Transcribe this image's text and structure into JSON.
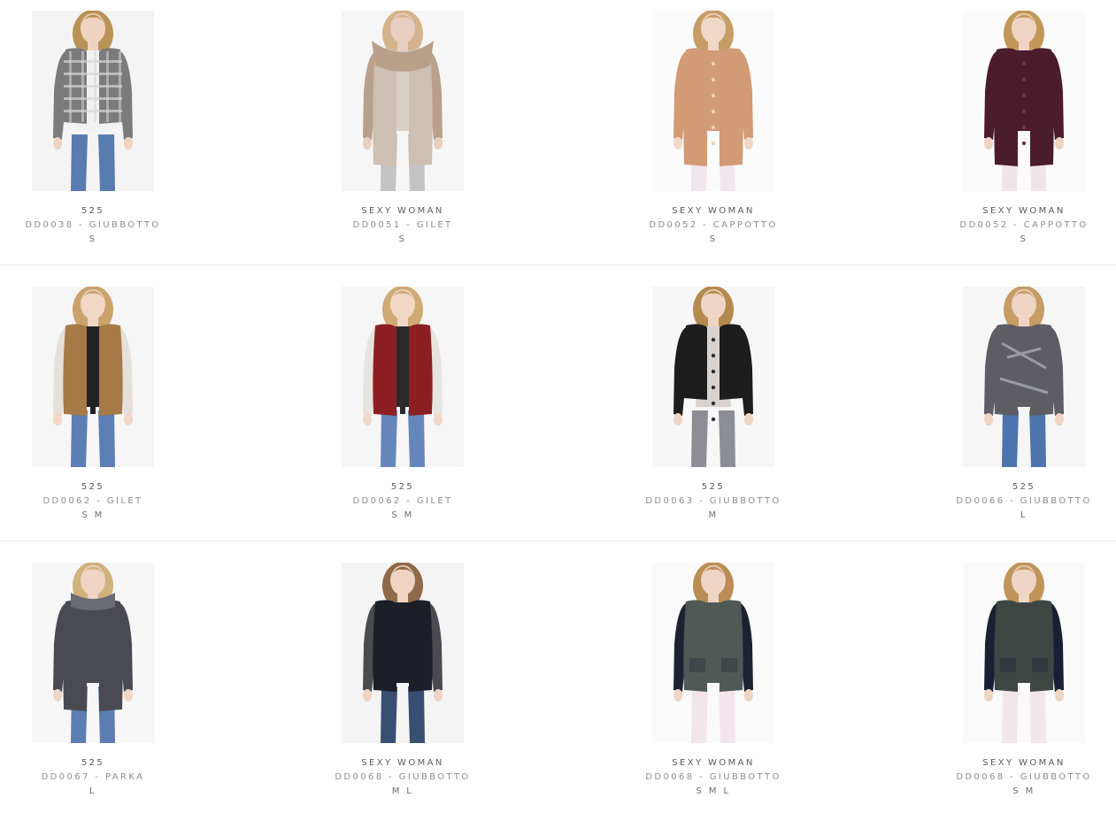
{
  "products": [
    {
      "brand": "525",
      "title": "DD0038 - GIUBBOTTO",
      "sizes": "S",
      "image": {
        "icon": "product-photo",
        "garment": "plaid-jacket",
        "colors": {
          "bg": "#f4f4f4",
          "hair": "#b99257",
          "skin": "#efd3c1",
          "coat": "#7b7b7b",
          "accent": "#d5d5d5",
          "inner": "#f1f1f1",
          "legs": "#587bb0"
        }
      }
    },
    {
      "brand": "SEXY WOMAN",
      "title": "DD0051 - GILET",
      "sizes": "S",
      "image": {
        "icon": "product-photo",
        "garment": "fur-collar-gilet",
        "colors": {
          "bg": "#f6f6f6",
          "hair": "#d4b38d",
          "skin": "#e7cfc1",
          "coat": "#cdbfb1",
          "accent": "#b9a08a",
          "inner": "#d7cfc8",
          "legs": "#c4c4c4"
        }
      }
    },
    {
      "brand": "SEXY WOMAN",
      "title": "DD0052 - CAPPOTTO",
      "sizes": "S",
      "image": {
        "icon": "product-photo",
        "garment": "plush-coat",
        "colors": {
          "bg": "#fbfbfb",
          "hair": "#c69d66",
          "skin": "#f0d8c8",
          "coat": "#d29a75",
          "accent": "#efcfb6",
          "inner": "#d29a75",
          "legs": "#f2e6ee"
        }
      }
    },
    {
      "brand": "SEXY WOMAN",
      "title": "DD0052 - CAPPOTTO",
      "sizes": "S",
      "image": {
        "icon": "product-photo",
        "garment": "velvet-coat",
        "colors": {
          "bg": "#fbfbfb",
          "hair": "#c29858",
          "skin": "#efd4c4",
          "coat": "#4a1c2c",
          "accent": "#6d3449",
          "inner": "#4a1c2c",
          "legs": "#f0e4ea"
        }
      }
    },
    {
      "brand": "525",
      "title": "DD0062 - GILET",
      "sizes": "S M",
      "image": {
        "icon": "product-photo",
        "garment": "faux-fur-vest",
        "colors": {
          "bg": "#f6f6f6",
          "hair": "#caa26b",
          "skin": "#f0d7c6",
          "coat": "#a57a46",
          "accent": "#e5e0da",
          "inner": "#222222",
          "legs": "#5b7eb4"
        }
      }
    },
    {
      "brand": "525",
      "title": "DD0062 - GILET",
      "sizes": "S M",
      "image": {
        "icon": "product-photo",
        "garment": "red-fur-vest",
        "colors": {
          "bg": "#f6f6f6",
          "hair": "#d0aa74",
          "skin": "#f0d7c6",
          "coat": "#8d1f22",
          "accent": "#e7e3de",
          "inner": "#2a2a2a",
          "legs": "#6486bb"
        }
      }
    },
    {
      "brand": "525",
      "title": "DD0063 - GIUBBOTTO",
      "sizes": "M",
      "image": {
        "icon": "product-photo",
        "garment": "shaggy-jacket",
        "colors": {
          "bg": "#f7f7f7",
          "hair": "#b58a4f",
          "skin": "#efd5c5",
          "coat": "#1d1d1d",
          "accent": "#303030",
          "inner": "#d9d3cf",
          "legs": "#8d8e95"
        }
      }
    },
    {
      "brand": "525",
      "title": "DD0066 - GIUBBOTTO",
      "sizes": "L",
      "image": {
        "icon": "product-photo",
        "garment": "metallic-jacket",
        "colors": {
          "bg": "#f6f6f6",
          "hair": "#c59d65",
          "skin": "#efd4c3",
          "coat": "#5d5d63",
          "accent": "#9b9ca2",
          "inner": "#5d5d63",
          "legs": "#4e74ad"
        }
      }
    },
    {
      "brand": "525",
      "title": "DD0067 - PARKA",
      "sizes": "L",
      "image": {
        "icon": "product-photo",
        "garment": "parka",
        "colors": {
          "bg": "#f7f7f7",
          "hair": "#d1b17c",
          "skin": "#efd5c5",
          "coat": "#4a4a52",
          "accent": "#6b6b74",
          "inner": "#4a4a52",
          "legs": "#5b7db1"
        }
      }
    },
    {
      "brand": "SEXY WOMAN",
      "title": "DD0068 - GIUBBOTTO",
      "sizes": "M L",
      "image": {
        "icon": "product-photo",
        "garment": "wool-jacket-leather-sleeves",
        "colors": {
          "bg": "#f4f4f4",
          "hair": "#8f6a48",
          "skin": "#efd4c4",
          "coat": "#1c1f28",
          "accent": "#4a4a4f",
          "inner": "#1c1f28",
          "legs": "#394f72"
        }
      }
    },
    {
      "brand": "SEXY WOMAN",
      "title": "DD0068 - GIUBBOTTO",
      "sizes": "S M L",
      "image": {
        "icon": "product-photo",
        "garment": "field-jacket",
        "colors": {
          "bg": "#fafafa",
          "hair": "#b98d54",
          "skin": "#efd5c5",
          "coat": "#505955",
          "accent": "#1d2233",
          "inner": "#505955",
          "legs": "#f2e6ec"
        }
      }
    },
    {
      "brand": "SEXY WOMAN",
      "title": "DD0068 - GIUBBOTTO",
      "sizes": "S M",
      "image": {
        "icon": "product-photo",
        "garment": "field-jacket",
        "colors": {
          "bg": "#fafafa",
          "hair": "#bf9559",
          "skin": "#efd5c5",
          "coat": "#3f4744",
          "accent": "#192033",
          "inner": "#3f4744",
          "legs": "#f2e6ec"
        }
      }
    }
  ]
}
